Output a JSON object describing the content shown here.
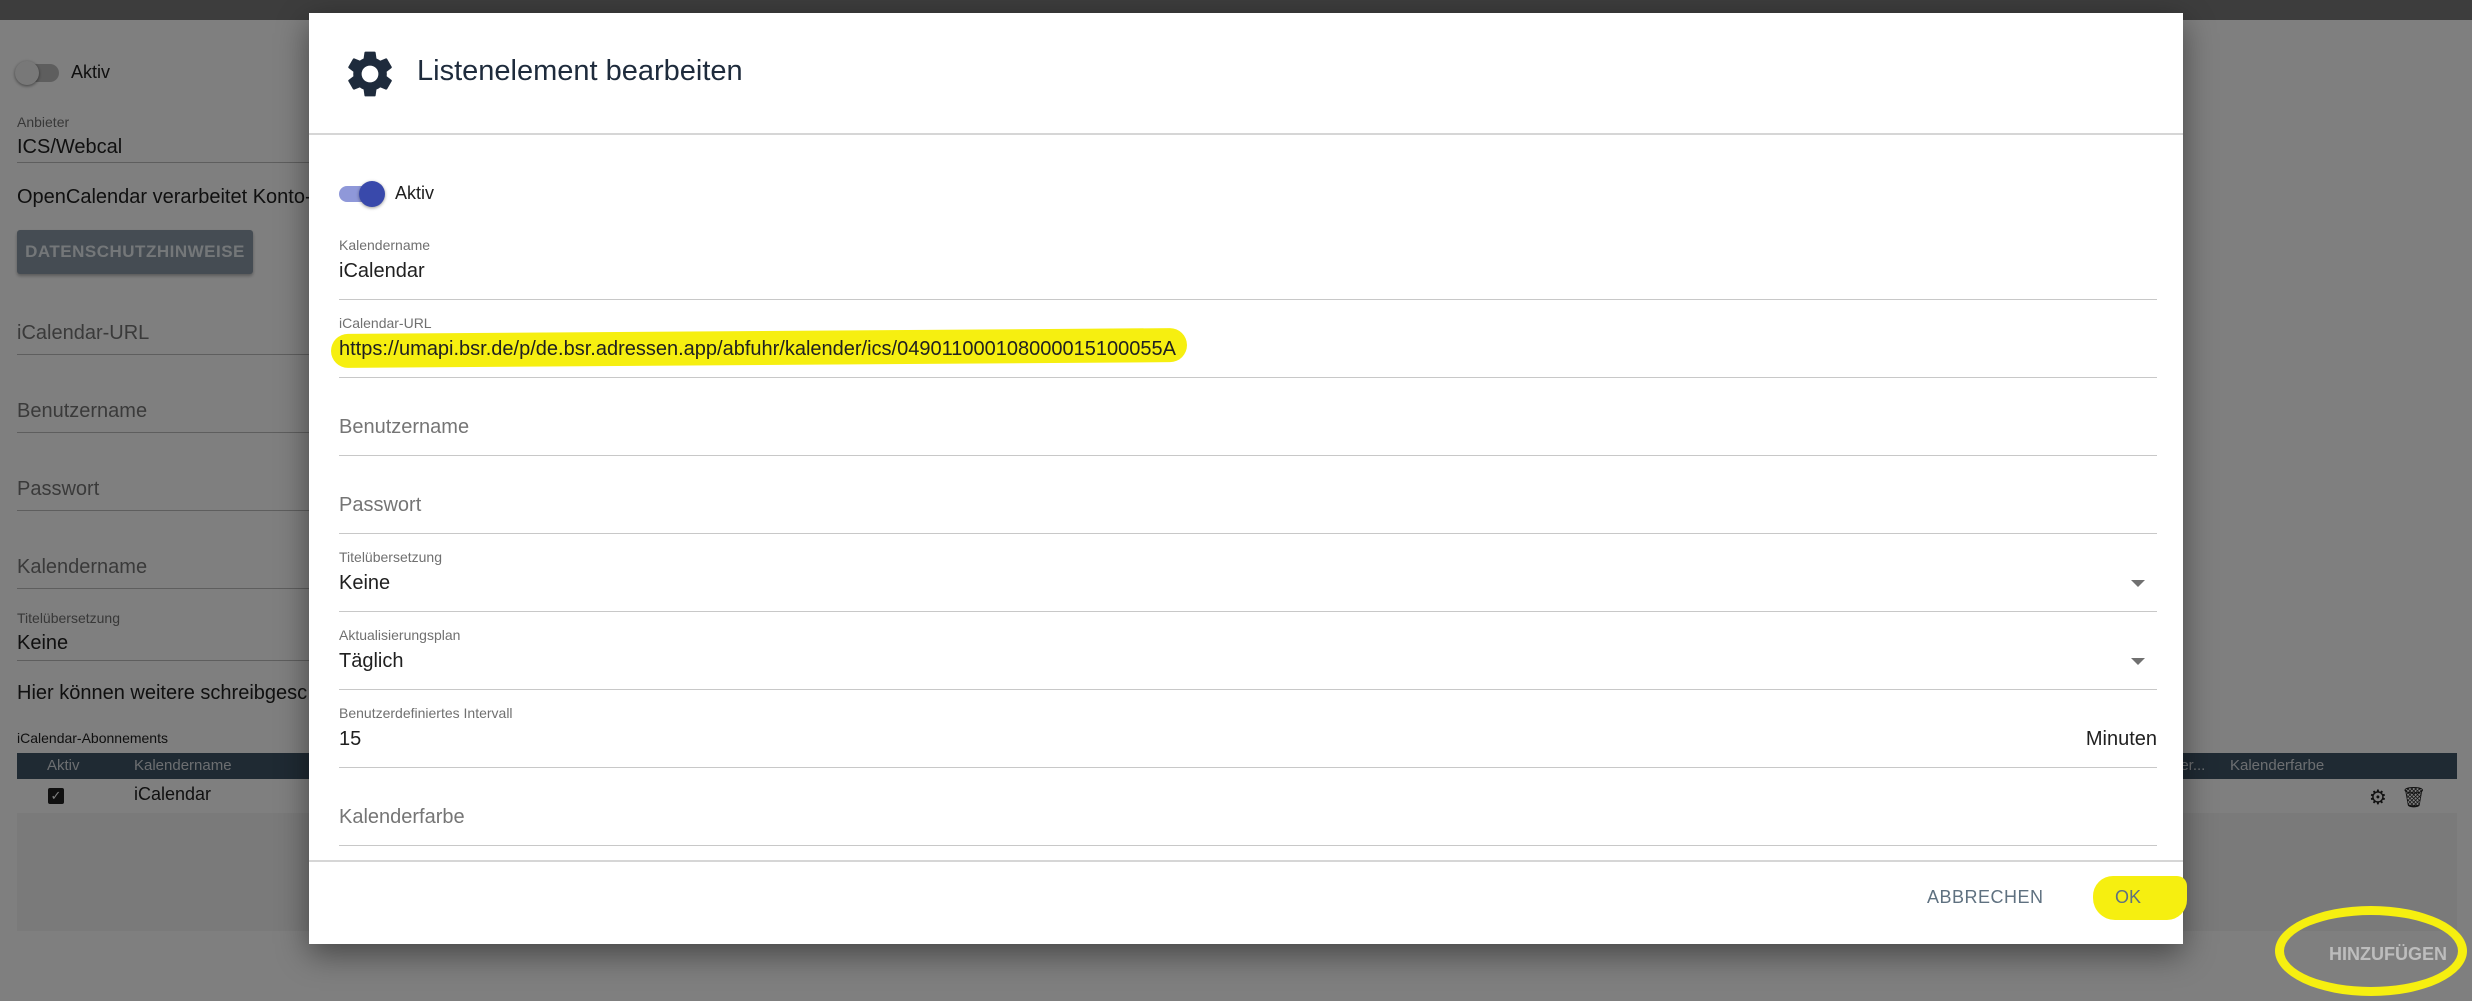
{
  "background": {
    "active_label": "Aktiv",
    "provider_label": "Anbieter",
    "provider_value": "ICS/Webcal",
    "info_text": "OpenCalendar verarbeitet Konto-",
    "privacy_button": "DATENSCHUTZHINWEISE",
    "url_placeholder": "iCalendar-URL",
    "username_placeholder": "Benutzername",
    "password_placeholder": "Passwort",
    "calname_placeholder": "Kalendername",
    "title_translation_label": "Titelübersetzung",
    "title_translation_value": "Keine",
    "more_text": "Hier können weitere schreibgesc",
    "subscriptions_label": "iCalendar-Abonnements",
    "table_headers": [
      "Aktiv",
      "Kalendername",
      "ier...",
      "Kalenderfarbe"
    ],
    "table_row": {
      "name": "iCalendar",
      "checked": true
    },
    "add_button": "HINZUFÜGEN"
  },
  "dialog": {
    "title": "Listenelement bearbeiten",
    "icon": "gear-icon",
    "active_label": "Aktiv",
    "active_on": true,
    "fields": {
      "calname": {
        "label": "Kalendername",
        "value": "iCalendar"
      },
      "url": {
        "label": "iCalendar-URL",
        "value": "https://umapi.bsr.de/p/de.bsr.adressen.app/abfuhr/kalender/ics/049011000108000015100055A"
      },
      "username": {
        "placeholder": "Benutzername"
      },
      "password": {
        "placeholder": "Passwort"
      },
      "title_translation": {
        "label": "Titelübersetzung",
        "value": "Keine"
      },
      "update_plan": {
        "label": "Aktualisierungsplan",
        "value": "Täglich"
      },
      "interval": {
        "label": "Benutzerdefiniertes Intervall",
        "value": "15",
        "suffix": "Minuten"
      },
      "color": {
        "placeholder": "Kalenderfarbe"
      }
    },
    "cancel_button": "ABBRECHEN",
    "ok_button": "OK"
  },
  "colors": {
    "accent": "#3949ab",
    "highlight": "#f6ef10",
    "header_bg": "#3f5566"
  }
}
